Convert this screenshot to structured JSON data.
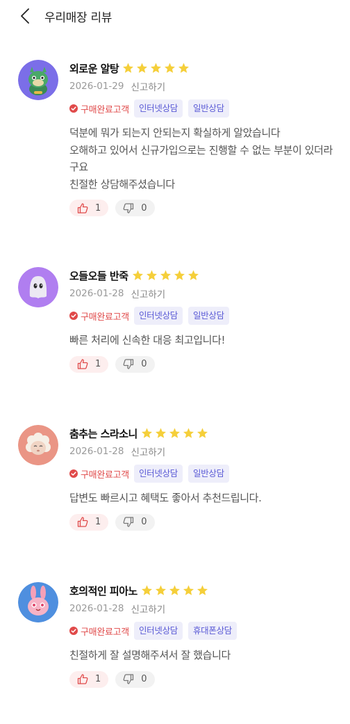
{
  "header": {
    "title": "우리매장 리뷰"
  },
  "colors": {
    "star": "#f5cf3a",
    "verified": "#e04a4a",
    "tag_text": "#5b5bd6",
    "tag_bg": "#eeeefa"
  },
  "reviews": [
    {
      "nickname": "외로운 알탕",
      "rating": 5,
      "date": "2026-01-29",
      "report_label": "신고하기",
      "verified_label": "구매완료고객",
      "tags": [
        "인터넷상담",
        "일반상담"
      ],
      "text": "덕분에 뭐가 되는지 안되는지 확실하게 알았습니다\n오해하고 있어서 신규가입으로는 진행할 수 없는 부분이 있더라구요\n친절한 상담해주셨습니다",
      "likes": "1",
      "dislikes": "0",
      "avatar_icon": "green-dragon-avatar",
      "avatar_bg": "#7b6ee8"
    },
    {
      "nickname": "오들오들 반죽",
      "rating": 5,
      "date": "2026-01-28",
      "report_label": "신고하기",
      "verified_label": "구매완료고객",
      "tags": [
        "인터넷상담",
        "일반상담"
      ],
      "text": "빠른 처리에 신속한 대응 최고입니다!",
      "likes": "1",
      "dislikes": "0",
      "avatar_icon": "dough-ghost-avatar",
      "avatar_bg": "#b07ef0"
    },
    {
      "nickname": "춤추는 스라소니",
      "rating": 5,
      "date": "2026-01-28",
      "report_label": "신고하기",
      "verified_label": "구매완료고객",
      "tags": [
        "인터넷상담",
        "일반상담"
      ],
      "text": "답변도 빠르시고 혜택도 좋아서 추천드립니다.",
      "likes": "1",
      "dislikes": "0",
      "avatar_icon": "sheep-avatar",
      "avatar_bg": "#ea9585"
    },
    {
      "nickname": "호의적인 피아노",
      "rating": 5,
      "date": "2026-01-28",
      "report_label": "신고하기",
      "verified_label": "구매완료고객",
      "tags": [
        "인터넷상담",
        "휴대폰상담"
      ],
      "text": "친절하게 잘 설명해주셔서 잘 했습니다",
      "likes": "1",
      "dislikes": "0",
      "avatar_icon": "pink-rabbit-avatar",
      "avatar_bg": "#4f8fdf"
    }
  ]
}
